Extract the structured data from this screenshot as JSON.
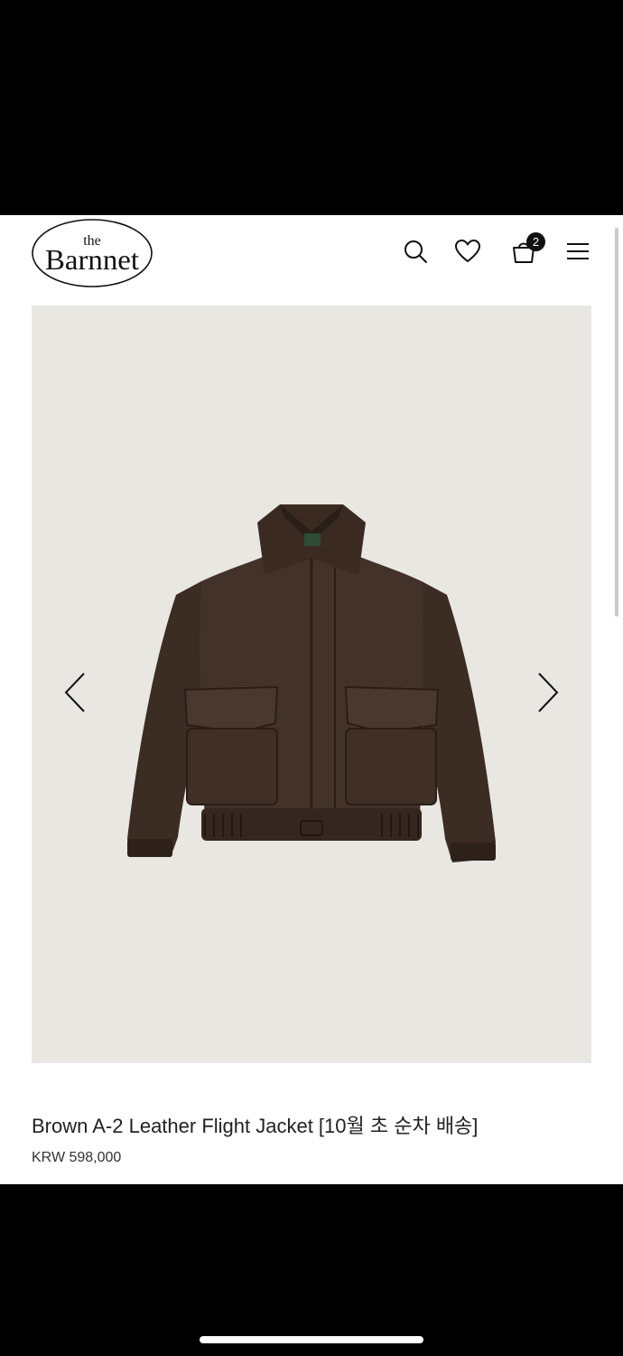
{
  "header": {
    "logo_small": "the",
    "logo_main": "Barnnet",
    "cart_count": "2",
    "icons": [
      "search-icon",
      "heart-icon",
      "shopping-bag-icon",
      "menu-icon"
    ]
  },
  "carousel": {
    "prev_icon": "chevron-left-icon",
    "next_icon": "chevron-right-icon"
  },
  "product": {
    "title": "Brown A-2 Leather Flight Jacket [10월 초 순차 배송]",
    "price": "KRW 598,000"
  },
  "colors": {
    "image_bg": "#e9e7e2",
    "jacket": "#3f2f27",
    "text": "#222222"
  }
}
